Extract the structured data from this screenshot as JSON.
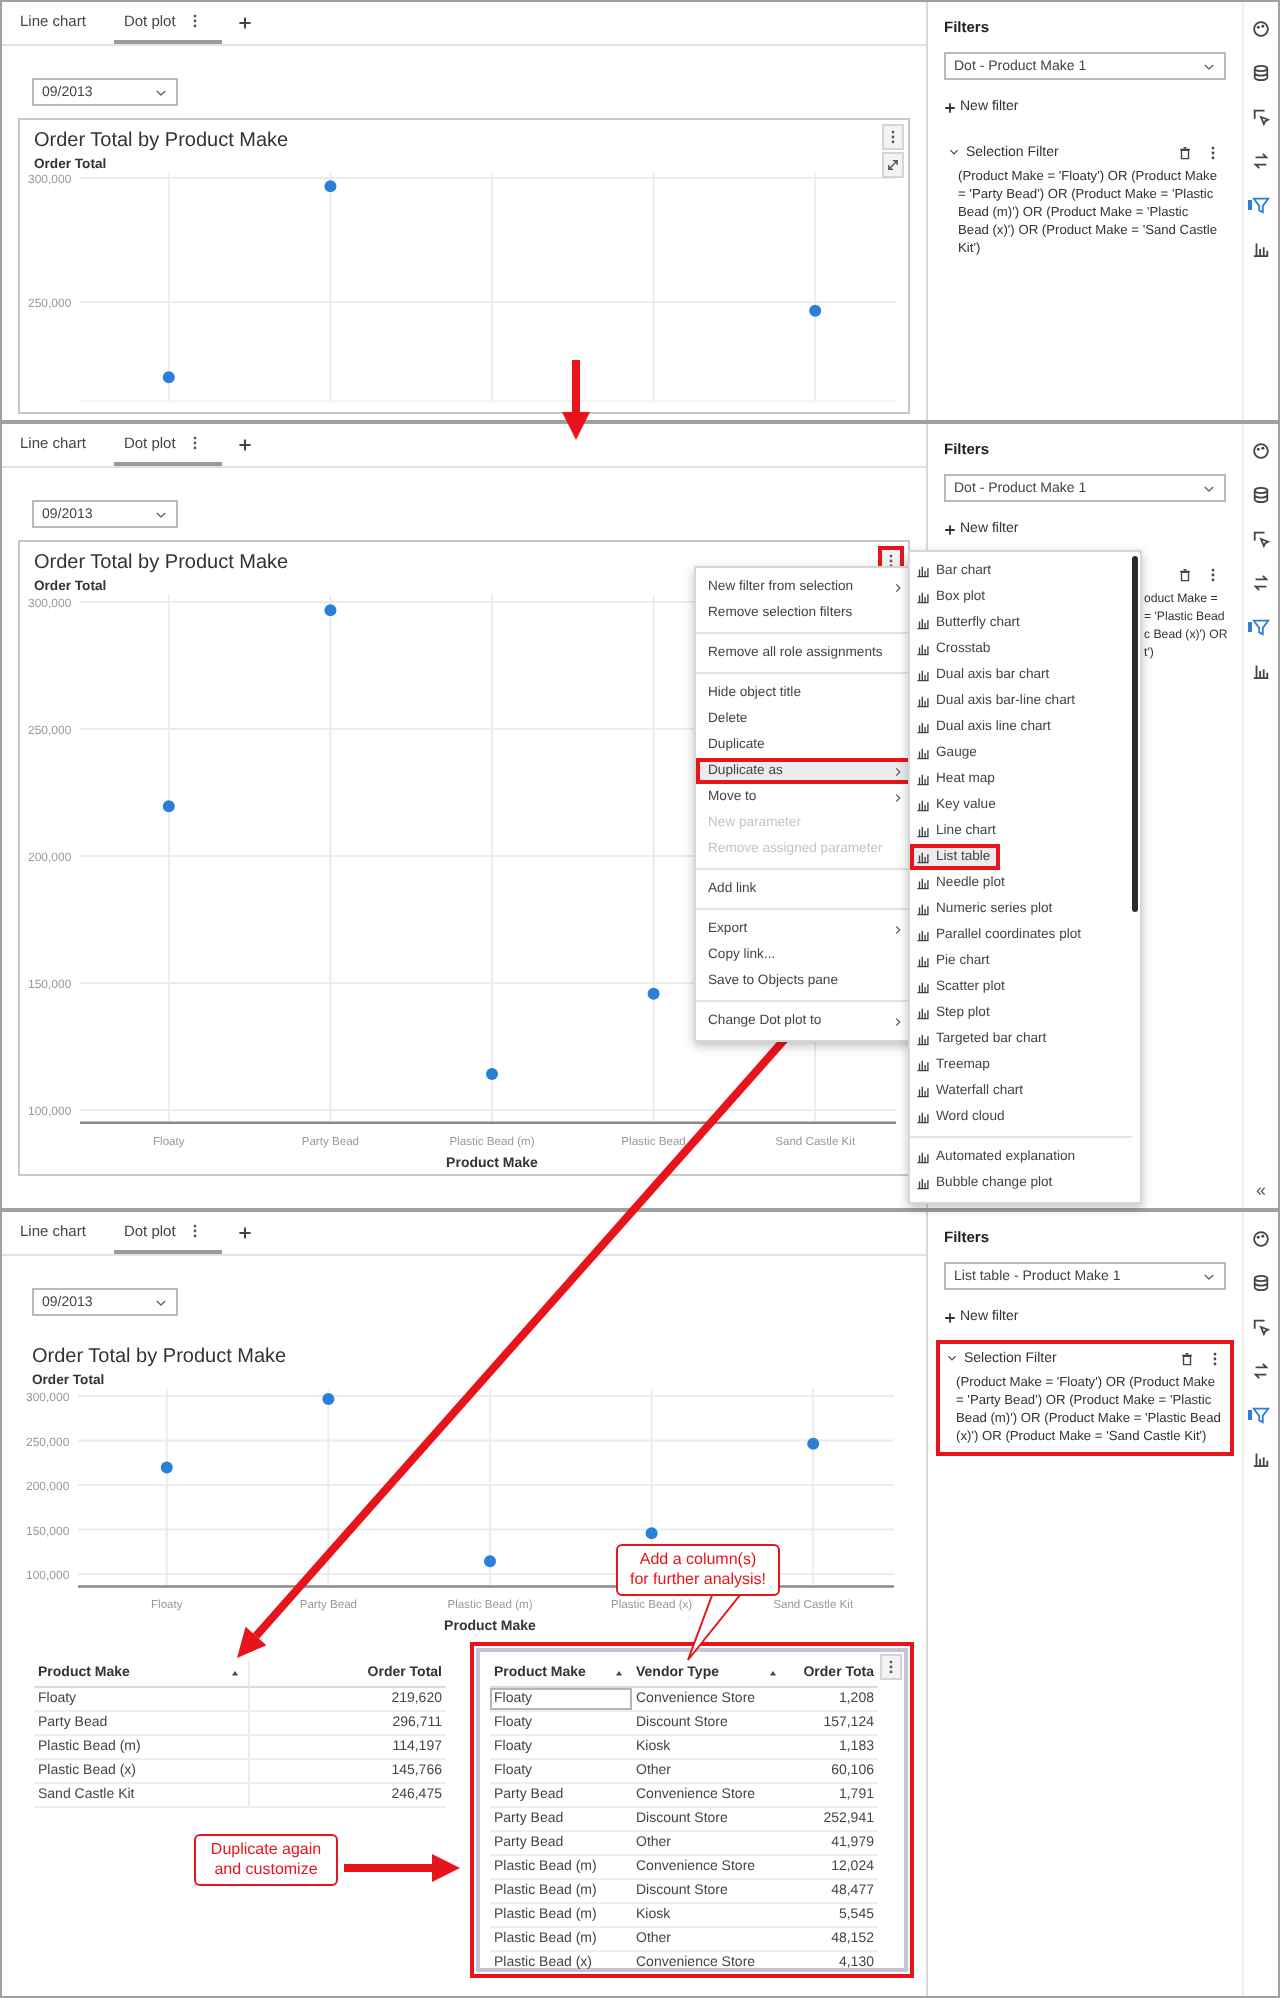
{
  "screens": [
    {
      "tabs": [
        {
          "label": "Line chart",
          "selected": false,
          "has_menu": false
        },
        {
          "label": "Dot plot",
          "selected": true,
          "has_menu": true
        }
      ],
      "date_filter": "09/2013",
      "chart": {
        "title": "Order Total by Product Make",
        "bordered": true,
        "controls": [
          {
            "kind": "more",
            "highlighted": false
          },
          {
            "kind": "expand",
            "highlighted": false
          }
        ],
        "chart_data": {
          "type": "scatter",
          "ylabel": "Order Total",
          "grid": true,
          "ylim": [
            210000,
            302000
          ],
          "yticks": [
            {
              "value": 250000,
              "label": "250,000"
            },
            {
              "value": 300000,
              "label": "300,000"
            }
          ],
          "series": [
            {
              "color": "#2b7fd6",
              "values": [
                219620,
                296711,
                null,
                null,
                246475
              ]
            }
          ]
        }
      },
      "filters": {
        "title": "Filters",
        "selector": "Dot - Product Make 1",
        "new_filter": "New filter",
        "items": [
          {
            "label": "Selection Filter",
            "expanded": true,
            "highlighted": false,
            "expression": "(Product Make = 'Floaty') OR (Product Make = 'Party Bead') OR (Product Make = 'Plastic Bead (m)') OR (Product Make = 'Plastic Bead (x)') OR (Product Make = 'Sand Castle Kit')"
          }
        ]
      },
      "rail": [
        {
          "kind": "palette",
          "selected": false
        },
        {
          "kind": "database",
          "selected": false
        },
        {
          "kind": "cursor",
          "selected": false
        },
        {
          "kind": "swap",
          "selected": false
        },
        {
          "kind": "filter",
          "selected": true
        },
        {
          "kind": "chart",
          "selected": false
        }
      ]
    },
    {
      "tabs": [
        {
          "label": "Line chart",
          "selected": false,
          "has_menu": false
        },
        {
          "label": "Dot plot",
          "selected": true,
          "has_menu": true
        }
      ],
      "date_filter": "09/2013",
      "chart": {
        "title": "Order Total by Product Make",
        "bordered": true,
        "controls": [
          {
            "kind": "more",
            "highlighted": true
          }
        ],
        "chart_data": {
          "type": "scatter",
          "xlabel": "Product Make",
          "ylabel": "Order Total",
          "grid": true,
          "categories": [
            "Floaty",
            "Party Bead",
            "Plastic Bead (m)",
            "Plastic Bead",
            "Sand Castle Kit"
          ],
          "ylim": [
            95000,
            303000
          ],
          "yticks": [
            {
              "value": 100000,
              "label": "100,000"
            },
            {
              "value": 150000,
              "label": "150,000"
            },
            {
              "value": 200000,
              "label": "200,000"
            },
            {
              "value": 250000,
              "label": "250,000"
            },
            {
              "value": 300000,
              "label": "300,000"
            }
          ],
          "series": [
            {
              "color": "#2b7fd6",
              "values": [
                219620,
                296711,
                114197,
                145766,
                null
              ]
            }
          ]
        }
      },
      "menu": {
        "groups": [
          {
            "items": [
              {
                "label": "New filter from selection",
                "submenu": true,
                "disabled": false,
                "selected": false,
                "highlighted": false
              },
              {
                "label": "Remove selection filters",
                "submenu": false,
                "disabled": false,
                "selected": false,
                "highlighted": false
              }
            ]
          },
          {
            "items": [
              {
                "label": "Remove all role assignments",
                "submenu": false,
                "disabled": false,
                "selected": false,
                "highlighted": false
              }
            ]
          },
          {
            "items": [
              {
                "label": "Hide object title",
                "submenu": false,
                "disabled": false,
                "selected": false,
                "highlighted": false
              },
              {
                "label": "Delete",
                "submenu": false,
                "disabled": false,
                "selected": false,
                "highlighted": false
              },
              {
                "label": "Duplicate",
                "submenu": false,
                "disabled": false,
                "selected": false,
                "highlighted": false
              },
              {
                "label": "Duplicate as",
                "submenu": true,
                "disabled": false,
                "selected": true,
                "highlighted": true
              },
              {
                "label": "Move to",
                "submenu": true,
                "disabled": false,
                "selected": false,
                "highlighted": false
              },
              {
                "label": "New parameter",
                "submenu": false,
                "disabled": true,
                "selected": false,
                "highlighted": false
              },
              {
                "label": "Remove assigned parameter",
                "submenu": false,
                "disabled": true,
                "selected": false,
                "highlighted": false
              }
            ]
          },
          {
            "items": [
              {
                "label": "Add link",
                "submenu": false,
                "disabled": false,
                "selected": false,
                "highlighted": false
              }
            ]
          },
          {
            "items": [
              {
                "label": "Export",
                "submenu": true,
                "disabled": false,
                "selected": false,
                "highlighted": false
              },
              {
                "label": "Copy link...",
                "submenu": false,
                "disabled": false,
                "selected": false,
                "highlighted": false
              },
              {
                "label": "Save to Objects pane",
                "submenu": false,
                "disabled": false,
                "selected": false,
                "highlighted": false
              }
            ]
          },
          {
            "items": [
              {
                "label": "Change Dot plot to",
                "submenu": true,
                "disabled": false,
                "selected": false,
                "highlighted": false
              }
            ]
          }
        ]
      },
      "submenu": {
        "groups": [
          {
            "items": [
              {
                "label": "Bar chart",
                "selected": false,
                "highlighted": false
              },
              {
                "label": "Box plot",
                "selected": false,
                "highlighted": false
              },
              {
                "label": "Butterfly chart",
                "selected": false,
                "highlighted": false
              },
              {
                "label": "Crosstab",
                "selected": false,
                "highlighted": false
              },
              {
                "label": "Dual axis bar chart",
                "selected": false,
                "highlighted": false
              },
              {
                "label": "Dual axis bar-line chart",
                "selected": false,
                "highlighted": false
              },
              {
                "label": "Dual axis line chart",
                "selected": false,
                "highlighted": false
              },
              {
                "label": "Gauge",
                "selected": false,
                "highlighted": false
              },
              {
                "label": "Heat map",
                "selected": false,
                "highlighted": false
              },
              {
                "label": "Key value",
                "selected": false,
                "highlighted": false
              },
              {
                "label": "Line chart",
                "selected": false,
                "highlighted": false
              },
              {
                "label": "List table",
                "selected": true,
                "highlighted": true
              },
              {
                "label": "Needle plot",
                "selected": false,
                "highlighted": false
              },
              {
                "label": "Numeric series plot",
                "selected": false,
                "highlighted": false
              },
              {
                "label": "Parallel coordinates plot",
                "selected": false,
                "highlighted": false
              },
              {
                "label": "Pie chart",
                "selected": false,
                "highlighted": false
              },
              {
                "label": "Scatter plot",
                "selected": false,
                "highlighted": false
              },
              {
                "label": "Step plot",
                "selected": false,
                "highlighted": false
              },
              {
                "label": "Targeted bar chart",
                "selected": false,
                "highlighted": false
              },
              {
                "label": "Treemap",
                "selected": false,
                "highlighted": false
              },
              {
                "label": "Waterfall chart",
                "selected": false,
                "highlighted": false
              },
              {
                "label": "Word cloud",
                "selected": false,
                "highlighted": false
              }
            ]
          },
          {
            "items": [
              {
                "label": "Automated explanation",
                "selected": false,
                "highlighted": false
              },
              {
                "label": "Bubble change plot",
                "selected": false,
                "highlighted": false
              }
            ]
          }
        ]
      },
      "filters": {
        "title": "Filters",
        "selector": "Dot - Product Make 1",
        "new_filter": "New filter",
        "items": [
          {
            "expanded": true,
            "highlighted": false,
            "expression_lines": [
              "oduct Make =",
              "= 'Plastic Bead",
              "c Bead (x)') OR",
              "t')"
            ]
          }
        ]
      },
      "rail": [
        {
          "kind": "palette",
          "selected": false
        },
        {
          "kind": "database",
          "selected": false
        },
        {
          "kind": "cursor",
          "selected": false
        },
        {
          "kind": "swap",
          "selected": false
        },
        {
          "kind": "filter",
          "selected": true
        },
        {
          "kind": "chart",
          "selected": false
        }
      ],
      "collapse": "«"
    },
    {
      "tabs": [
        {
          "label": "Line chart",
          "selected": false,
          "has_menu": false
        },
        {
          "label": "Dot plot",
          "selected": true,
          "has_menu": true
        }
      ],
      "date_filter": "09/2013",
      "chart": {
        "title": "Order Total by Product Make",
        "bordered": false,
        "chart_data": {
          "type": "scatter",
          "xlabel": "Product Make",
          "ylabel": "Order Total",
          "grid": true,
          "categories": [
            "Floaty",
            "Party Bead",
            "Plastic Bead (m)",
            "Plastic Bead (x)",
            "Sand Castle Kit"
          ],
          "ylim": [
            86000,
            308000
          ],
          "yticks": [
            {
              "value": 100000,
              "label": "100,000"
            },
            {
              "value": 150000,
              "label": "150,000"
            },
            {
              "value": 200000,
              "label": "200,000"
            },
            {
              "value": 250000,
              "label": "250,000"
            },
            {
              "value": 300000,
              "label": "300,000"
            }
          ],
          "series": [
            {
              "color": "#2b7fd6",
              "values": [
                219620,
                296711,
                114197,
                145766,
                246475
              ]
            }
          ]
        }
      },
      "tables": [
        {
          "highlighted": false,
          "columns": [
            {
              "label": "Product Make",
              "sorted": true
            },
            {
              "label": "Order Total",
              "sorted": false
            }
          ],
          "rows": [
            {
              "cells": [
                "Floaty",
                "219,620"
              ],
              "focused": false
            },
            {
              "cells": [
                "Party Bead",
                "296,711"
              ],
              "focused": false
            },
            {
              "cells": [
                "Plastic Bead (m)",
                "114,197"
              ],
              "focused": false
            },
            {
              "cells": [
                "Plastic Bead (x)",
                "145,766"
              ],
              "focused": false
            },
            {
              "cells": [
                "Sand Castle Kit",
                "246,475"
              ],
              "focused": false
            }
          ]
        },
        {
          "highlighted": true,
          "columns": [
            {
              "label": "Product Make",
              "sorted": true
            },
            {
              "label": "Vendor Type",
              "sorted": true
            },
            {
              "label": "Order Tota",
              "sorted": false
            }
          ],
          "rows": [
            {
              "cells": [
                "Floaty",
                "Convenience Store",
                "1,208"
              ],
              "focused": true
            },
            {
              "cells": [
                "Floaty",
                "Discount Store",
                "157,124"
              ],
              "focused": false
            },
            {
              "cells": [
                "Floaty",
                "Kiosk",
                "1,183"
              ],
              "focused": false
            },
            {
              "cells": [
                "Floaty",
                "Other",
                "60,106"
              ],
              "focused": false
            },
            {
              "cells": [
                "Party Bead",
                "Convenience Store",
                "1,791"
              ],
              "focused": false
            },
            {
              "cells": [
                "Party Bead",
                "Discount Store",
                "252,941"
              ],
              "focused": false
            },
            {
              "cells": [
                "Party Bead",
                "Other",
                "41,979"
              ],
              "focused": false
            },
            {
              "cells": [
                "Plastic Bead (m)",
                "Convenience Store",
                "12,024"
              ],
              "focused": false
            },
            {
              "cells": [
                "Plastic Bead (m)",
                "Discount Store",
                "48,477"
              ],
              "focused": false
            },
            {
              "cells": [
                "Plastic Bead (m)",
                "Kiosk",
                "5,545"
              ],
              "focused": false
            },
            {
              "cells": [
                "Plastic Bead (m)",
                "Other",
                "48,152"
              ],
              "focused": false
            },
            {
              "cells": [
                "Plastic Bead (x)",
                "Convenience Store",
                "4,130"
              ],
              "focused": false
            }
          ]
        }
      ],
      "filters": {
        "title": "Filters",
        "selector": "List table - Product Make 1",
        "new_filter": "New filter",
        "items": [
          {
            "label": "Selection Filter",
            "expanded": true,
            "highlighted": true,
            "expression": "(Product Make = 'Floaty') OR (Product Make = 'Party Bead') OR (Product Make = 'Plastic Bead (m)') OR (Product Make = 'Plastic Bead (x)') OR (Product Make = 'Sand Castle Kit')"
          }
        ]
      },
      "rail": [
        {
          "kind": "palette",
          "selected": false
        },
        {
          "kind": "database",
          "selected": false
        },
        {
          "kind": "cursor",
          "selected": false
        },
        {
          "kind": "swap",
          "selected": false
        },
        {
          "kind": "filter",
          "selected": true
        },
        {
          "kind": "chart",
          "selected": false
        }
      ]
    }
  ],
  "annotations": [
    {
      "text": "Add a column(s)\nfor further analysis!"
    },
    {
      "text": "Duplicate again\nand customize"
    }
  ]
}
